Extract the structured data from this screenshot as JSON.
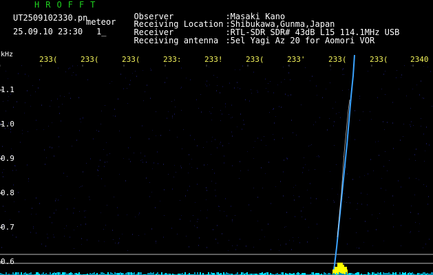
{
  "header": {
    "brand": "HROFFT",
    "filename": "UT2509102330.pn",
    "mode": "meteor",
    "datetime": "25.09.10 23:30",
    "page_marker": "1_"
  },
  "info": [
    {
      "label": "Observer",
      "value": ":Masaki Kano"
    },
    {
      "label": "Receiving Location",
      "value": ":Shibukawa,Gunma,Japan"
    },
    {
      "label": "Receiver",
      "value": ":RTL-SDR SDR# 43dB L15 114.1MHz USB"
    },
    {
      "label": "Receiving antenna",
      "value": ":5el Yagi Az 20 for Aomori VOR"
    }
  ],
  "axes": {
    "y_unit": "kHz",
    "x_ticks": [
      "233(",
      "233(",
      "233(",
      "233:",
      "233!",
      "233(",
      "233'",
      "233(",
      "233(",
      "2340"
    ],
    "y_ticks": [
      "1.1",
      "1.0",
      "0.9",
      "0.8",
      "0.7",
      "0.6"
    ]
  },
  "colors": {
    "background": "#000000",
    "brand": "#1fd01f",
    "x_ticks": "#f2f25a",
    "trace": "#3aa3ff",
    "echo": "#ffff00",
    "baseline": "#00c8e0",
    "hline": "#c0c0c0"
  }
}
